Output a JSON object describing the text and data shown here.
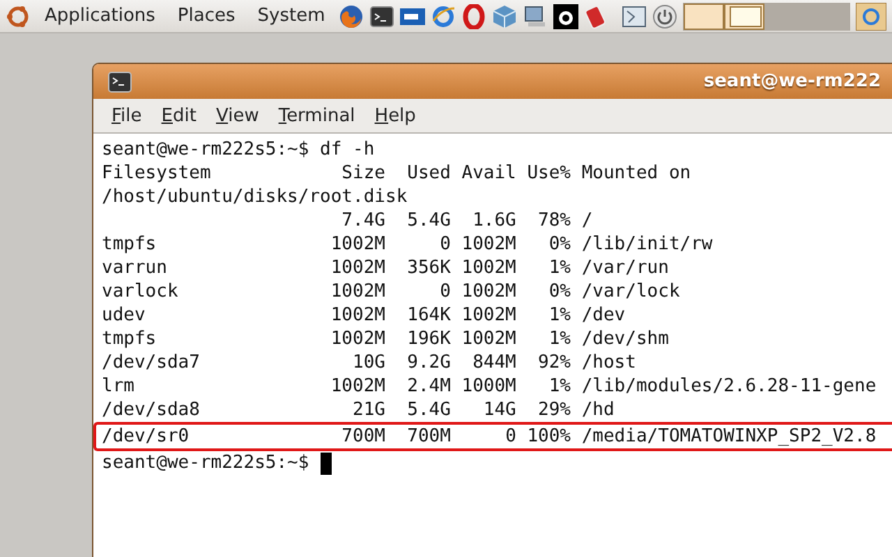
{
  "panel": {
    "menus": [
      "Applications",
      "Places",
      "System"
    ]
  },
  "window": {
    "title": "seant@we-rm222",
    "menu": [
      "File",
      "Edit",
      "View",
      "Terminal",
      "Help"
    ]
  },
  "terminal": {
    "command_prompt": "seant@we-rm222s5:~$",
    "command": "df -h",
    "header": {
      "filesystem": "Filesystem",
      "size": "Size",
      "used": "Used",
      "avail": "Avail",
      "use": "Use%",
      "mounted": "Mounted on"
    },
    "rows": [
      {
        "filesystem": "/host/ubuntu/disks/root.disk",
        "highlighted": false
      },
      {
        "size": "7.4G",
        "used": "5.4G",
        "avail": "1.6G",
        "use": "78%",
        "mounted": "/",
        "highlighted": false
      },
      {
        "filesystem": "tmpfs",
        "size": "1002M",
        "used": "0",
        "avail": "1002M",
        "use": "0%",
        "mounted": "/lib/init/rw",
        "highlighted": false
      },
      {
        "filesystem": "varrun",
        "size": "1002M",
        "used": "356K",
        "avail": "1002M",
        "use": "1%",
        "mounted": "/var/run",
        "highlighted": false
      },
      {
        "filesystem": "varlock",
        "size": "1002M",
        "used": "0",
        "avail": "1002M",
        "use": "0%",
        "mounted": "/var/lock",
        "highlighted": false
      },
      {
        "filesystem": "udev",
        "size": "1002M",
        "used": "164K",
        "avail": "1002M",
        "use": "1%",
        "mounted": "/dev",
        "highlighted": false
      },
      {
        "filesystem": "tmpfs",
        "size": "1002M",
        "used": "196K",
        "avail": "1002M",
        "use": "1%",
        "mounted": "/dev/shm",
        "highlighted": false
      },
      {
        "filesystem": "/dev/sda7",
        "size": "10G",
        "used": "9.2G",
        "avail": "844M",
        "use": "92%",
        "mounted": "/host",
        "highlighted": false
      },
      {
        "filesystem": "lrm",
        "size": "1002M",
        "used": "2.4M",
        "avail": "1000M",
        "use": "1%",
        "mounted": "/lib/modules/2.6.28-11-gene",
        "highlighted": false
      },
      {
        "filesystem": "/dev/sda8",
        "size": "21G",
        "used": "5.4G",
        "avail": "14G",
        "use": "29%",
        "mounted": "/hd",
        "highlighted": false
      },
      {
        "filesystem": "/dev/sr0",
        "size": "700M",
        "used": "700M",
        "avail": "0",
        "use": "100%",
        "mounted": "/media/TOMATOWINXP_SP2_V2.8",
        "highlighted": true
      }
    ],
    "final_prompt": "seant@we-rm222s5:~$"
  }
}
